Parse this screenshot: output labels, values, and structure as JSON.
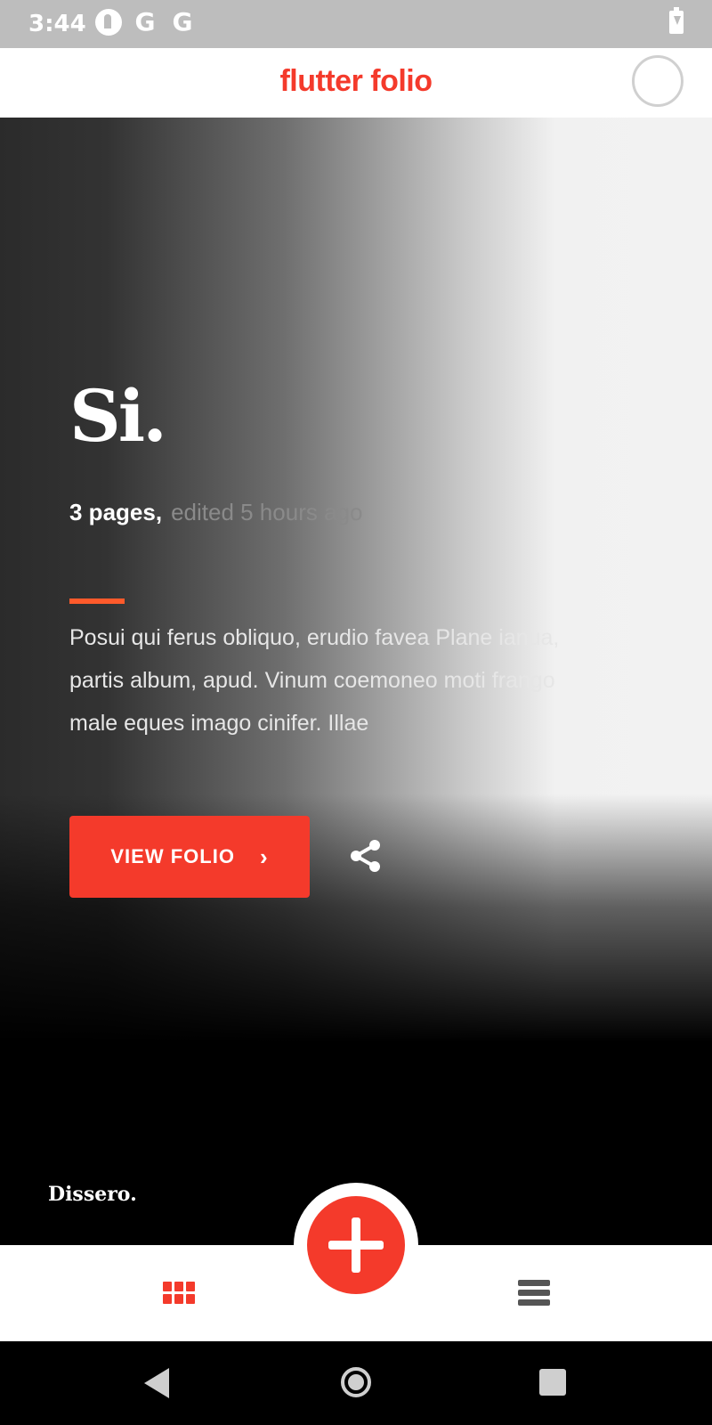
{
  "status_bar": {
    "time": "3:44",
    "icons": [
      "app-notification-icon",
      "google-icon",
      "google-icon",
      "battery-charging-icon"
    ],
    "g1": "G",
    "g2": "G"
  },
  "header": {
    "title": "flutter folio"
  },
  "folio": {
    "title": "Si.",
    "pages": "3 pages,",
    "edited": "edited 5 hours ago",
    "description": "Posui qui ferus obliquo, erudio favea Plane ianua, partis album, apud. Vinum coemoneo moti frango male eques imago cinifer. Illae",
    "view_label": "VIEW FOLIO",
    "view_chevron": "›",
    "publisher": "Dissero."
  },
  "colors": {
    "accent": "#f43a2b",
    "rule": "#ff5a2b"
  },
  "bottom_nav": {
    "items": [
      "grid-view-icon",
      "add-icon",
      "list-view-icon"
    ]
  },
  "system_nav": {
    "items": [
      "back-icon",
      "home-icon",
      "recents-icon"
    ]
  }
}
